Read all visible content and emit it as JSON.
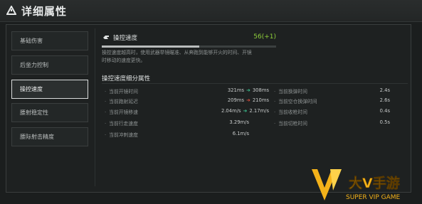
{
  "header": {
    "title": "详细属性",
    "icon": "alert-triangle-icon"
  },
  "sidebar": {
    "items": [
      {
        "label": "基础伤害",
        "active": false
      },
      {
        "label": "后坐力控制",
        "active": false
      },
      {
        "label": "操控速度",
        "active": true
      },
      {
        "label": "腰射稳定性",
        "active": false
      },
      {
        "label": "腰际射击精度",
        "active": false
      }
    ]
  },
  "speed": {
    "icon": "hand-icon",
    "label": "操控速度",
    "value": "56(+1)",
    "progress": 0.56,
    "description_line1": "操控速度越高时，使用武器举镜瞄准、从奔跑到能够开火的时间、开镜",
    "description_line2": "时移动的速度更快。"
  },
  "section": {
    "title": "操控速度细分属性"
  },
  "left_rows": [
    {
      "label": "当前开镜时间",
      "from": "321ms",
      "arrow": "down",
      "to": "308ms"
    },
    {
      "label": "当前跑射延迟",
      "from": "209ms",
      "arrow": "up",
      "to": "210ms"
    },
    {
      "label": "当前开镜移速",
      "from": "2.04m/s",
      "arrow": "down",
      "to": "2.17m/s"
    },
    {
      "label": "当前行走速度",
      "value": "3.29m/s"
    },
    {
      "label": "当前冲刺速度",
      "value": "6.1m/s"
    }
  ],
  "right_rows": [
    {
      "label": "当前换弹时间",
      "value": "2.4s"
    },
    {
      "label": "当前空仓换弹时间",
      "value": "2.6s"
    },
    {
      "label": "当前收枪时间",
      "value": "0.4s"
    },
    {
      "label": "当前切枪时间",
      "value": "0.5s"
    }
  ],
  "logo": {
    "text": "大V手游",
    "subtext": "SUPER VIP GAME"
  },
  "colors": {
    "accent_green": "#8fd03a",
    "arrow_down": "#39b98a",
    "arrow_up": "#d24a3a",
    "logo_yellow": "#f4b21a"
  }
}
